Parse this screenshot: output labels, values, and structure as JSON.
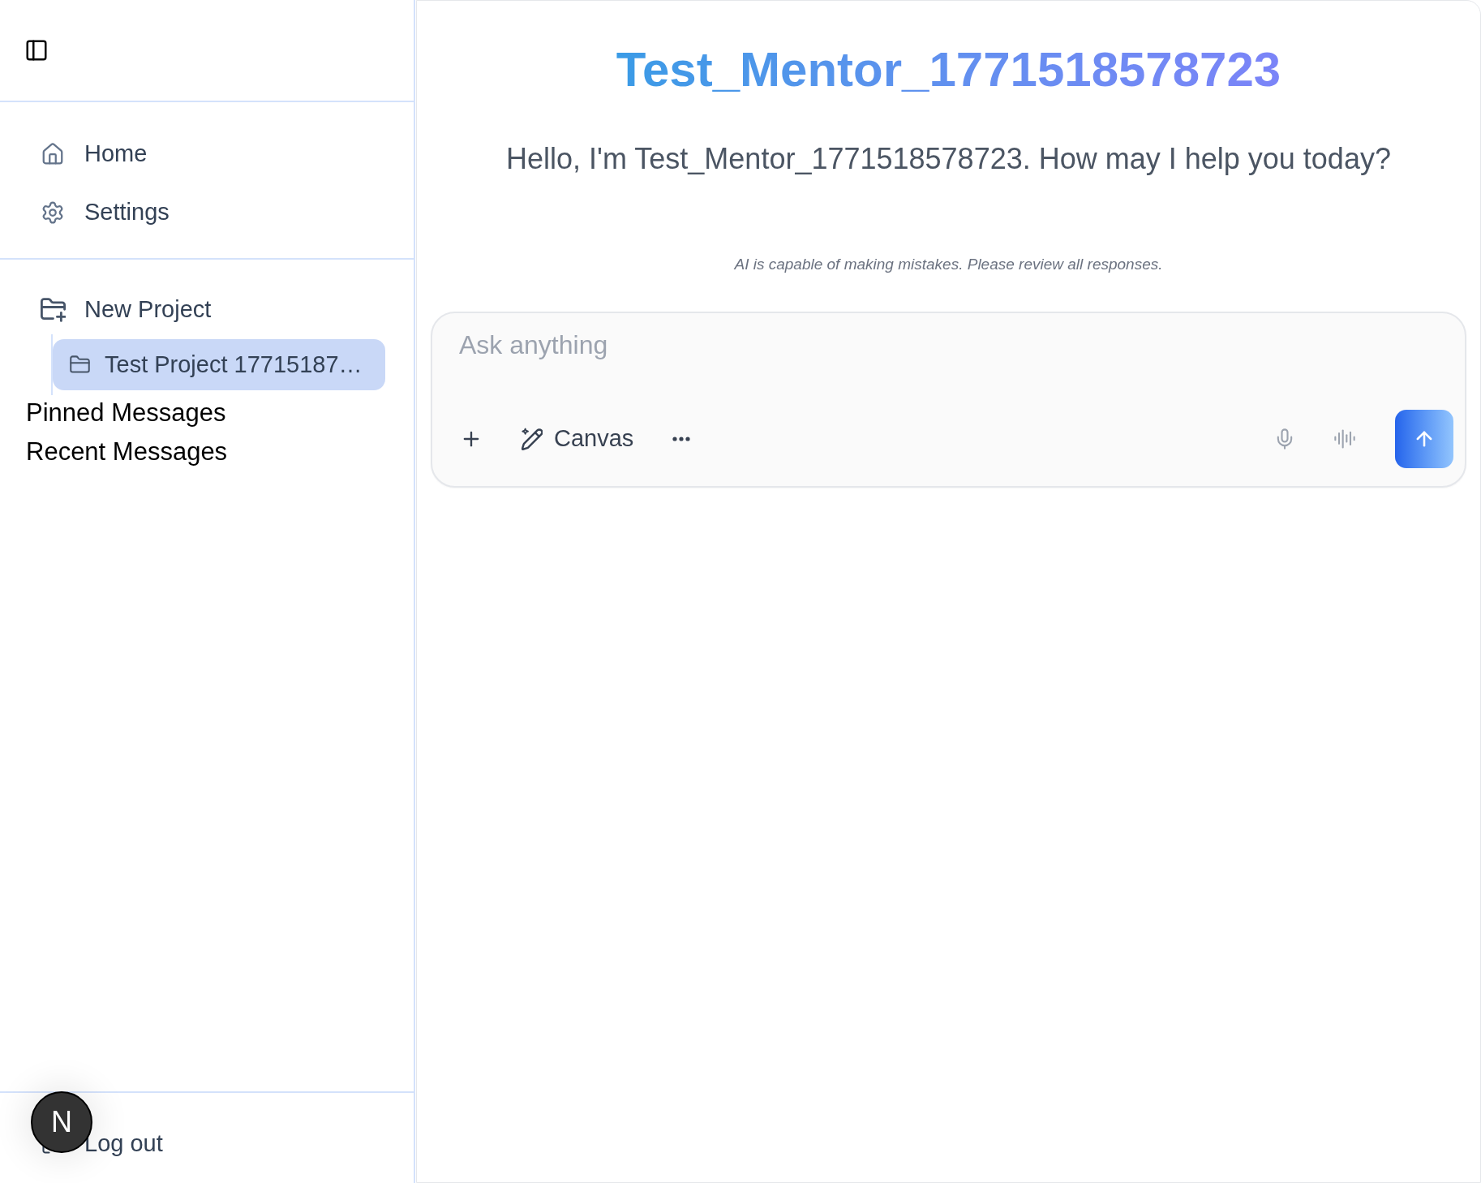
{
  "sidebar": {
    "nav": [
      {
        "kind": "home",
        "label": "Home",
        "selected": false
      },
      {
        "kind": "settings",
        "label": "Settings",
        "selected": false
      }
    ],
    "projects": {
      "new_label": "New Project",
      "items": [
        {
          "label": "Test Project 17715187…",
          "selected": true
        }
      ]
    },
    "sections": [
      "Pinned Messages",
      "Recent Messages"
    ],
    "logout": {
      "label": "Log out"
    }
  },
  "chat": {
    "title": "Test_Mentor_1771518578723",
    "greeting": "Hello, I'm Test_Mentor_1771518578723. How may I help you today?",
    "disclaimer": "AI is capable of making mistakes. Please review all responses.",
    "composer": {
      "placeholder": "Ask anything",
      "canvas_label": "Canvas"
    }
  },
  "dev_badge": {
    "label": "N"
  }
}
